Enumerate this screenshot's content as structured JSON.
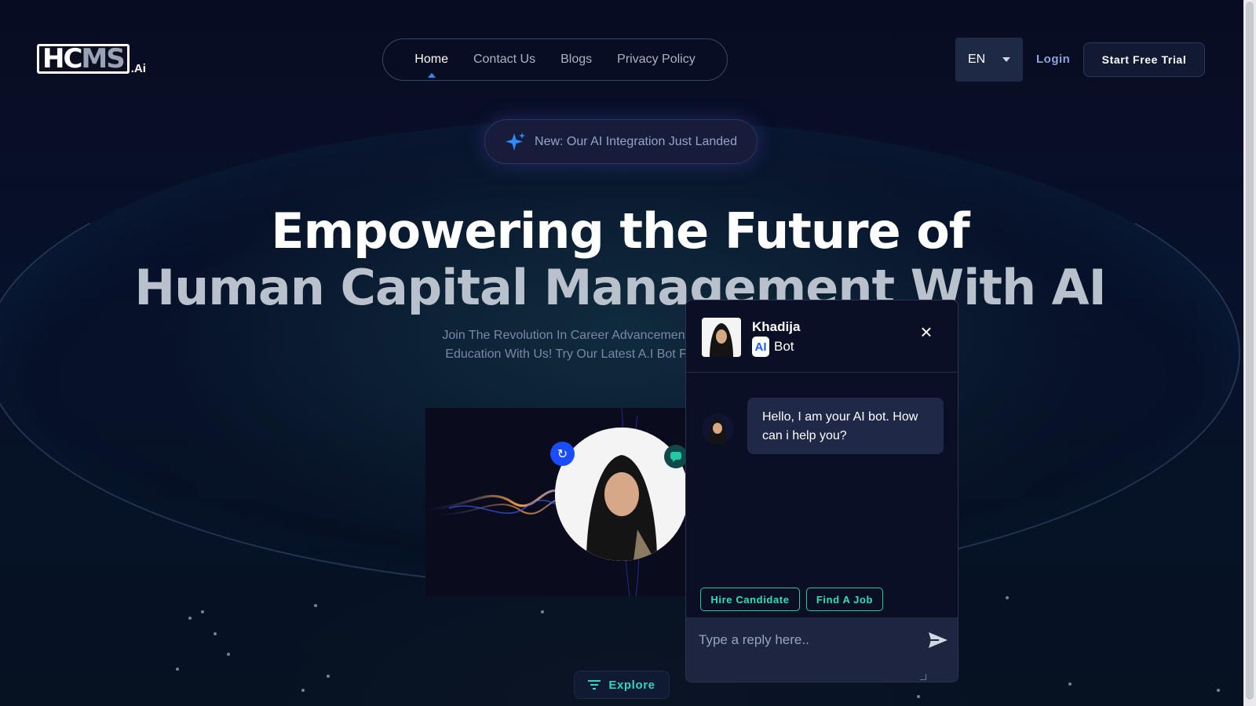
{
  "header": {
    "logo": {
      "hc": "HC",
      "ms": "MS",
      "suffix": ".Ai"
    },
    "nav": [
      {
        "label": "Home",
        "active": true
      },
      {
        "label": "Contact Us"
      },
      {
        "label": "Blogs"
      },
      {
        "label": "Privacy Policy"
      }
    ],
    "language": "EN",
    "login_label": "Login",
    "trial_label": "Start Free Trial"
  },
  "announcement": {
    "text": "New: Our AI Integration Just Landed",
    "icon": "sparkle-icon"
  },
  "hero": {
    "title_line1": "Empowering the Future of",
    "title_line2": "Human Capital Management With AI",
    "subtitle_line1": "Join The Revolution In Career Advancement Ar",
    "subtitle_line2": "Education With Us! Try Our Latest A.I Bot Fea"
  },
  "explore_label": "Explore",
  "chat": {
    "bot_name": "Khadija",
    "badge": "AI",
    "bot_role": "Bot",
    "message": "Hello, I am your AI bot. How can i help you?",
    "quick_replies": [
      "Hire Candidate",
      "Find A Job"
    ],
    "input_placeholder": "Type a reply here.."
  },
  "colors": {
    "accent": "#2f8cff",
    "teal": "#22c9a4",
    "background": "#080c22"
  }
}
